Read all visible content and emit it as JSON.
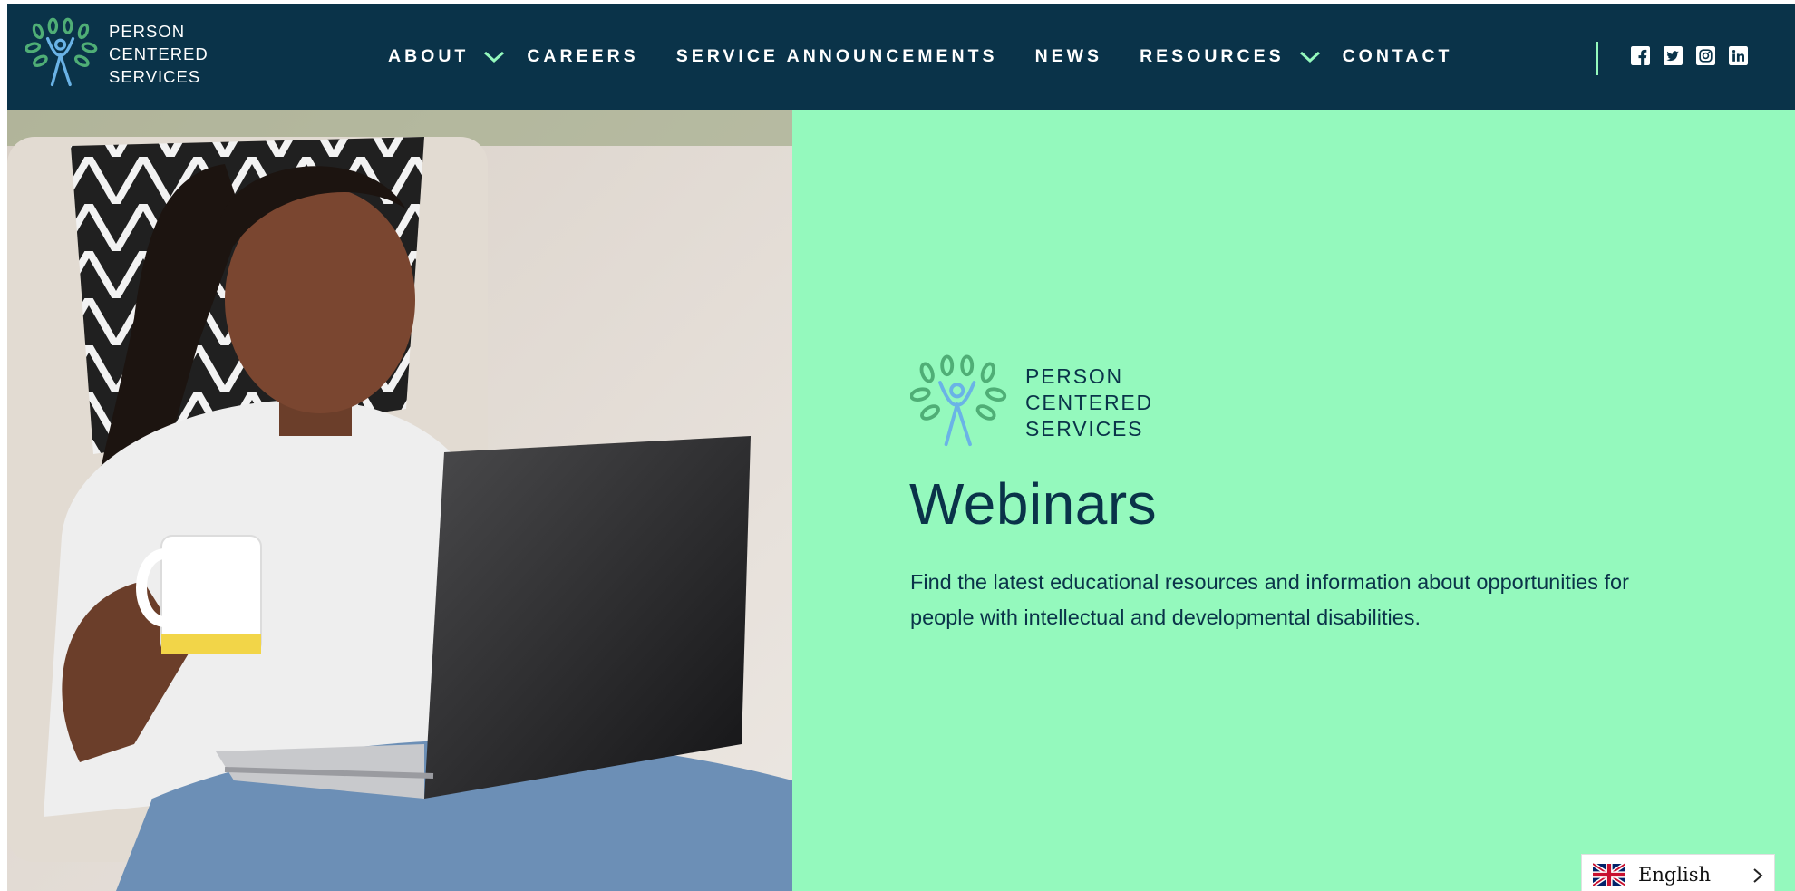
{
  "brand": {
    "lines": [
      "PERSON",
      "CENTERED",
      "SERVICES"
    ],
    "colors": {
      "navy": "#0a3349",
      "mint": "#94f9bd",
      "leaf_green": "#4fae76",
      "figure_blue": "#6ab3e6"
    }
  },
  "nav": {
    "items": [
      {
        "label": "ABOUT",
        "has_dropdown": true
      },
      {
        "label": "CAREERS",
        "has_dropdown": false
      },
      {
        "label": "SERVICE ANNOUNCEMENTS",
        "has_dropdown": false
      },
      {
        "label": "NEWS",
        "has_dropdown": false
      },
      {
        "label": "RESOURCES",
        "has_dropdown": true
      },
      {
        "label": "CONTACT",
        "has_dropdown": false
      }
    ]
  },
  "social": {
    "icons": [
      "facebook-icon",
      "twitter-icon",
      "instagram-icon",
      "linkedin-icon"
    ]
  },
  "hero": {
    "image_alt": "Woman holding a coffee mug while looking at a laptop",
    "logo_lines": [
      "PERSON",
      "CENTERED",
      "SERVICES"
    ],
    "title": "Webinars",
    "description": "Find the latest educational resources and information about opportunities for people with intellectual and developmental disabilities."
  },
  "language_selector": {
    "label": "English",
    "flag": "uk-flag-icon"
  }
}
